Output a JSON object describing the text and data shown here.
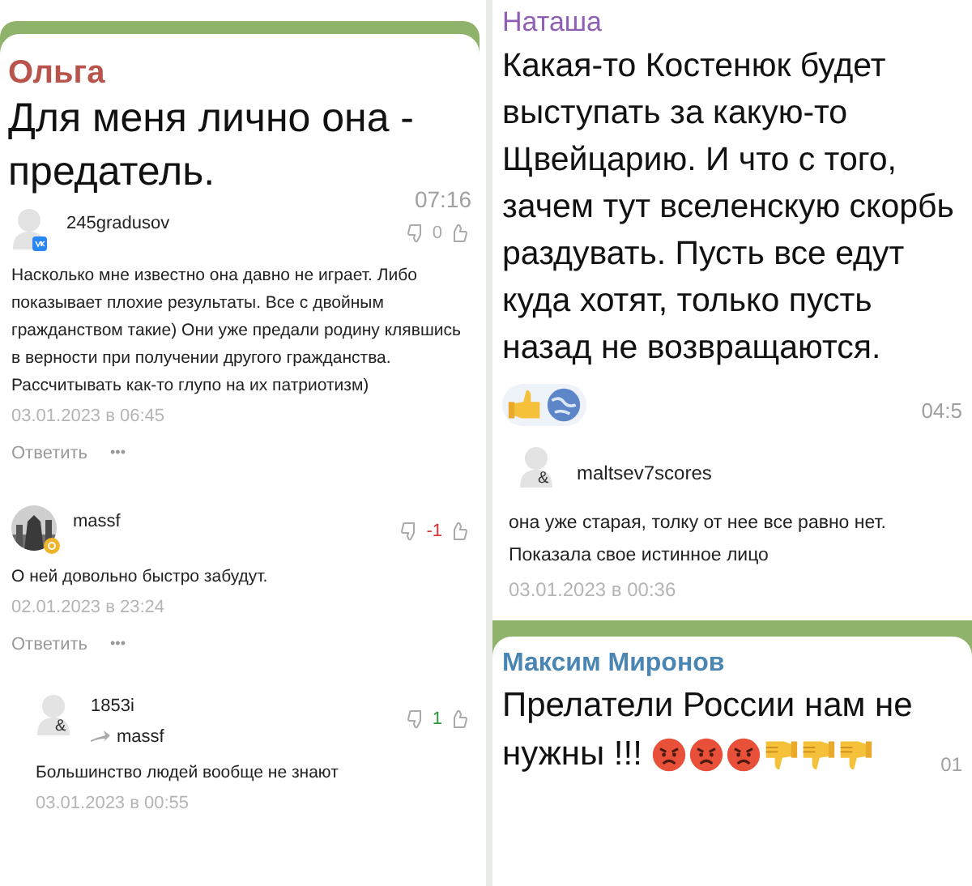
{
  "left": {
    "message": {
      "author": "Ольга",
      "color": "#b8544c",
      "text": "Для меня лично она - предатель.",
      "time": "07:16"
    },
    "comments": [
      {
        "user": "245gradusov",
        "kind": "vk",
        "score": "0",
        "color": "#aaaaaa",
        "text": "Насколько мне известно она давно не играет. Либо показывает плохие результаты. Все с двойным гражданством такие) Они уже предали родину клявшись в верности при получении другого гражданства. Рассчитывать как-то глупо на их патриотизм)",
        "date": "03.01.2023 в 06:45",
        "reply": "Ответить",
        "more": "•••"
      },
      {
        "user": "massf",
        "score": "-1",
        "color": "#dd3333",
        "text": "О ней довольно быстро забудут.",
        "date": "02.01.2023 в 23:24",
        "reply": "Ответить",
        "more": "•••"
      },
      {
        "user": "1853i",
        "kind": "blank",
        "badge": "&",
        "reply_to": "massf",
        "nested": true,
        "score": "1",
        "color": "#2a9d3a",
        "text": "Большинство людей вообще не знают",
        "date": "03.01.2023 в 00:55"
      }
    ]
  },
  "right": {
    "message": {
      "author": "Наташа",
      "color": "#8e5fb3",
      "text": "Какая-то Костенюк будет выступать за какую-то Щвейцарию. И что с того, зачем тут вселенскую скорбь раздувать. Пусть все едут куда хотят, только пусть назад не возвращаются.",
      "time": "04:5"
    },
    "comment": {
      "user": "maltsev7scores",
      "badge": "&",
      "text": "она уже старая, толку от нее все равно нет. Показала свое истинное лицо",
      "date": "03.01.2023 в 00:36"
    },
    "message2": {
      "author": "Максим Миронов",
      "color": "#4a86b4",
      "text": "Прелатели России нам не нужны !!!",
      "emojis": [
        {
          "kind": "angry"
        },
        {
          "kind": "angry"
        },
        {
          "kind": "angry"
        },
        {
          "kind": "thumbs_down"
        },
        {
          "kind": "thumbs_down"
        },
        {
          "kind": "thumbs_down"
        }
      ],
      "time": "01"
    }
  }
}
